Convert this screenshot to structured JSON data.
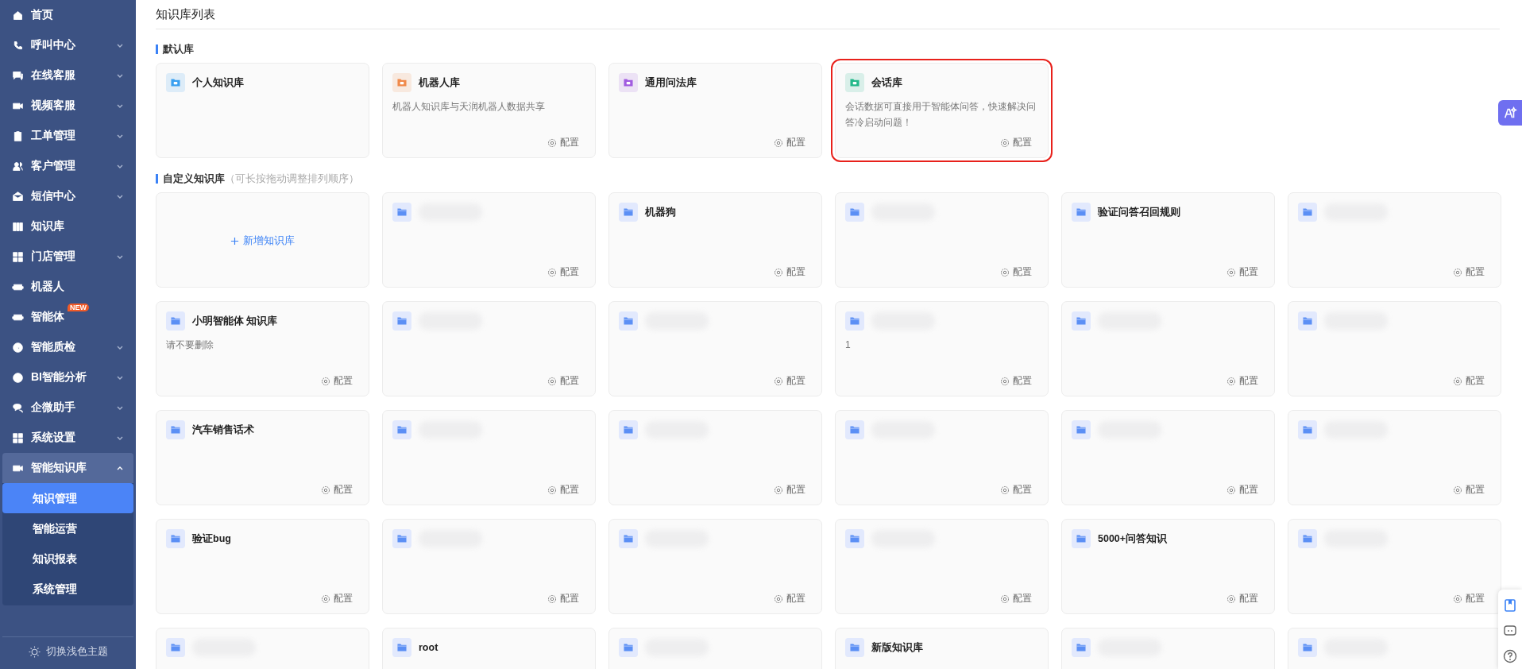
{
  "sidebar": {
    "items": [
      {
        "label": "首页",
        "expandable": false,
        "expanded": false
      },
      {
        "label": "呼叫中心",
        "expandable": true,
        "expanded": false
      },
      {
        "label": "在线客服",
        "expandable": true,
        "expanded": false
      },
      {
        "label": "视频客服",
        "expandable": true,
        "expanded": false
      },
      {
        "label": "工单管理",
        "expandable": true,
        "expanded": false
      },
      {
        "label": "客户管理",
        "expandable": true,
        "expanded": false
      },
      {
        "label": "短信中心",
        "expandable": true,
        "expanded": false
      },
      {
        "label": "知识库",
        "expandable": false,
        "expanded": false
      },
      {
        "label": "门店管理",
        "expandable": true,
        "expanded": false
      },
      {
        "label": "机器人",
        "expandable": false,
        "expanded": false
      },
      {
        "label": "智能体",
        "expandable": false,
        "expanded": false,
        "badge": "NEW"
      },
      {
        "label": "智能质检",
        "expandable": true,
        "expanded": false
      },
      {
        "label": "BI智能分析",
        "expandable": true,
        "expanded": false
      },
      {
        "label": "企微助手",
        "expandable": true,
        "expanded": false
      },
      {
        "label": "系统设置",
        "expandable": true,
        "expanded": false
      },
      {
        "label": "智能知识库",
        "expandable": true,
        "expanded": true,
        "children": [
          {
            "label": "知识管理",
            "selected": true
          },
          {
            "label": "智能运营",
            "selected": false
          },
          {
            "label": "知识报表",
            "selected": false
          },
          {
            "label": "系统管理",
            "selected": false
          }
        ]
      }
    ],
    "theme_toggle": "切换浅色主题"
  },
  "page_title": "知识库列表",
  "default_section": {
    "title": "默认库",
    "cards": [
      {
        "title": "个人知识库",
        "color": "#3aa0f0",
        "highlighted": false
      },
      {
        "title": "机器人库",
        "description": "机器人知识库与天润机器人数据共享",
        "action": "配置",
        "color": "#f08a4b",
        "highlighted": false
      },
      {
        "title": "通用问法库",
        "action": "配置",
        "color": "#a15be0",
        "highlighted": false
      },
      {
        "title": "会话库",
        "description": "会话数据可直接用于智能体问答，快速解决问答冷启动问题！",
        "action": "配置",
        "color": "#23b88a",
        "highlighted": true
      }
    ]
  },
  "custom_section": {
    "title": "自定义知识库",
    "hint": "（可长按拖动调整排列顺序）",
    "cards": [
      {
        "kind": "add",
        "title": "新增知识库"
      },
      {
        "kind": "kb",
        "title_blurred": true,
        "action": "配置"
      },
      {
        "kind": "kb",
        "title": "机器狗",
        "action": "配置"
      },
      {
        "kind": "kb",
        "title_blurred": true,
        "action": "配置"
      },
      {
        "kind": "kb",
        "title": "验证问答召回规则",
        "action": "配置"
      },
      {
        "kind": "kb",
        "title_blurred": true,
        "action": "配置"
      },
      {
        "kind": "kb",
        "title": "小明智能体 知识库",
        "description": "请不要删除",
        "action": "配置"
      },
      {
        "kind": "kb",
        "title_blurred": true,
        "action": "配置"
      },
      {
        "kind": "kb",
        "title_blurred": true,
        "action": "配置"
      },
      {
        "kind": "kb",
        "title_blurred": true,
        "description": "1",
        "action": "配置"
      },
      {
        "kind": "kb",
        "title_blurred": true,
        "action": "配置"
      },
      {
        "kind": "kb",
        "title_blurred": true,
        "action": "配置"
      },
      {
        "kind": "kb",
        "title": "汽车销售话术",
        "action": "配置"
      },
      {
        "kind": "kb",
        "title_blurred": true,
        "action": "配置"
      },
      {
        "kind": "kb",
        "title_blurred": true,
        "action": "配置"
      },
      {
        "kind": "kb",
        "title_blurred": true,
        "action": "配置"
      },
      {
        "kind": "kb",
        "title_blurred": true,
        "action": "配置"
      },
      {
        "kind": "kb",
        "title_blurred": true,
        "action": "配置"
      },
      {
        "kind": "kb",
        "title": "验证bug",
        "action": "配置"
      },
      {
        "kind": "kb",
        "title_blurred": true,
        "action": "配置"
      },
      {
        "kind": "kb",
        "title_blurred": true,
        "action": "配置"
      },
      {
        "kind": "kb",
        "title_blurred": true,
        "action": "配置"
      },
      {
        "kind": "kb",
        "title": "5000+问答知识",
        "action": "配置"
      },
      {
        "kind": "kb",
        "title_blurred": true,
        "action": "配置"
      },
      {
        "kind": "kb",
        "title_blurred": true
      },
      {
        "kind": "kb",
        "title": "root"
      },
      {
        "kind": "kb",
        "title_blurred": true
      },
      {
        "kind": "kb",
        "title": "新版知识库"
      },
      {
        "kind": "kb",
        "title_blurred": true
      },
      {
        "kind": "kb",
        "title_blurred": true
      }
    ]
  }
}
